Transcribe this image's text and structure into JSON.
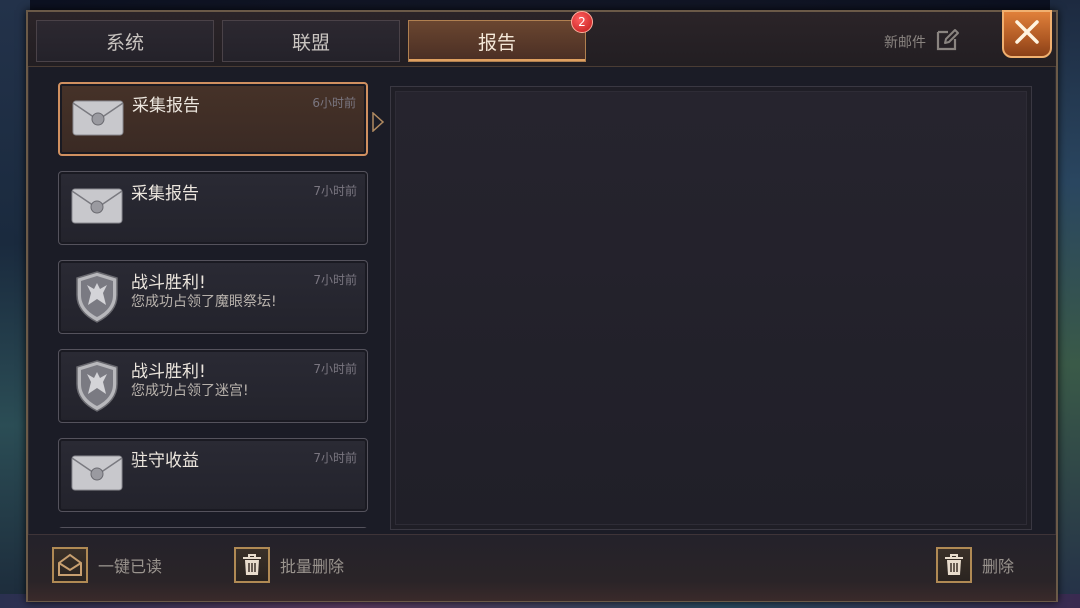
{
  "tabs": [
    {
      "label": "系统",
      "active": false
    },
    {
      "label": "联盟",
      "active": false
    },
    {
      "label": "报告",
      "active": true,
      "badge": "2"
    }
  ],
  "header": {
    "new_mail_label": "新邮件",
    "new_mail_icon": "edit-icon",
    "close_icon": "close-icon"
  },
  "mails": [
    {
      "title": "采集报告",
      "time": "6小时前",
      "subtitle": "",
      "icon": "envelope-icon",
      "selected": true
    },
    {
      "title": "采集报告",
      "time": "7小时前",
      "subtitle": "",
      "icon": "envelope-icon",
      "selected": false
    },
    {
      "title": "战斗胜利!",
      "time": "7小时前",
      "subtitle": "您成功占领了魔眼祭坛!",
      "icon": "wolf-shield-icon",
      "selected": false
    },
    {
      "title": "战斗胜利!",
      "time": "7小时前",
      "subtitle": "您成功占领了迷宫!",
      "icon": "wolf-shield-icon",
      "selected": false
    },
    {
      "title": "驻守收益",
      "time": "7小时前",
      "subtitle": "",
      "icon": "envelope-icon",
      "selected": false
    }
  ],
  "footer": {
    "read_all_label": "一键已读",
    "batch_delete_label": "批量删除",
    "delete_label": "删除"
  },
  "colors": {
    "accent": "#d09060",
    "badge": "#d02020",
    "close_button": "#c8682c"
  }
}
